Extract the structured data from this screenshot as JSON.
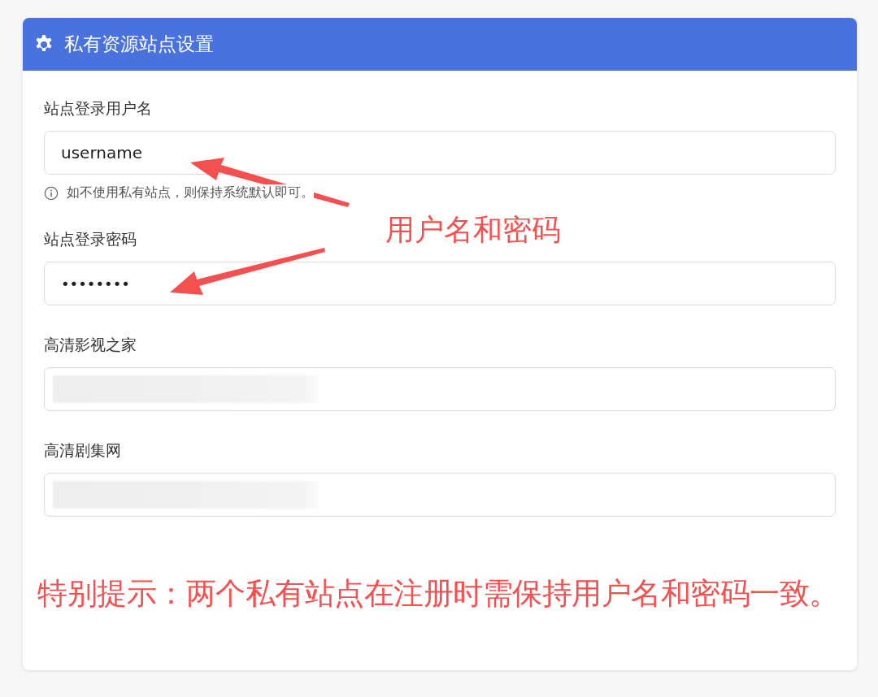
{
  "panel": {
    "title": "私有资源站点设置"
  },
  "fields": [
    {
      "label": "站点登录用户名",
      "kind": "text",
      "value": "username",
      "hint": "如不使用私有站点，则保持系统默认即可。"
    },
    {
      "label": "站点登录密码",
      "kind": "password",
      "value": "••••••••"
    },
    {
      "label": "高清影视之家",
      "kind": "blurred"
    },
    {
      "label": "高清剧集网",
      "kind": "blurred"
    }
  ],
  "annotations": {
    "callout": "用户名和密码",
    "note": "特别提示：两个私有站点在注册时需保持用户名和密码一致。"
  }
}
